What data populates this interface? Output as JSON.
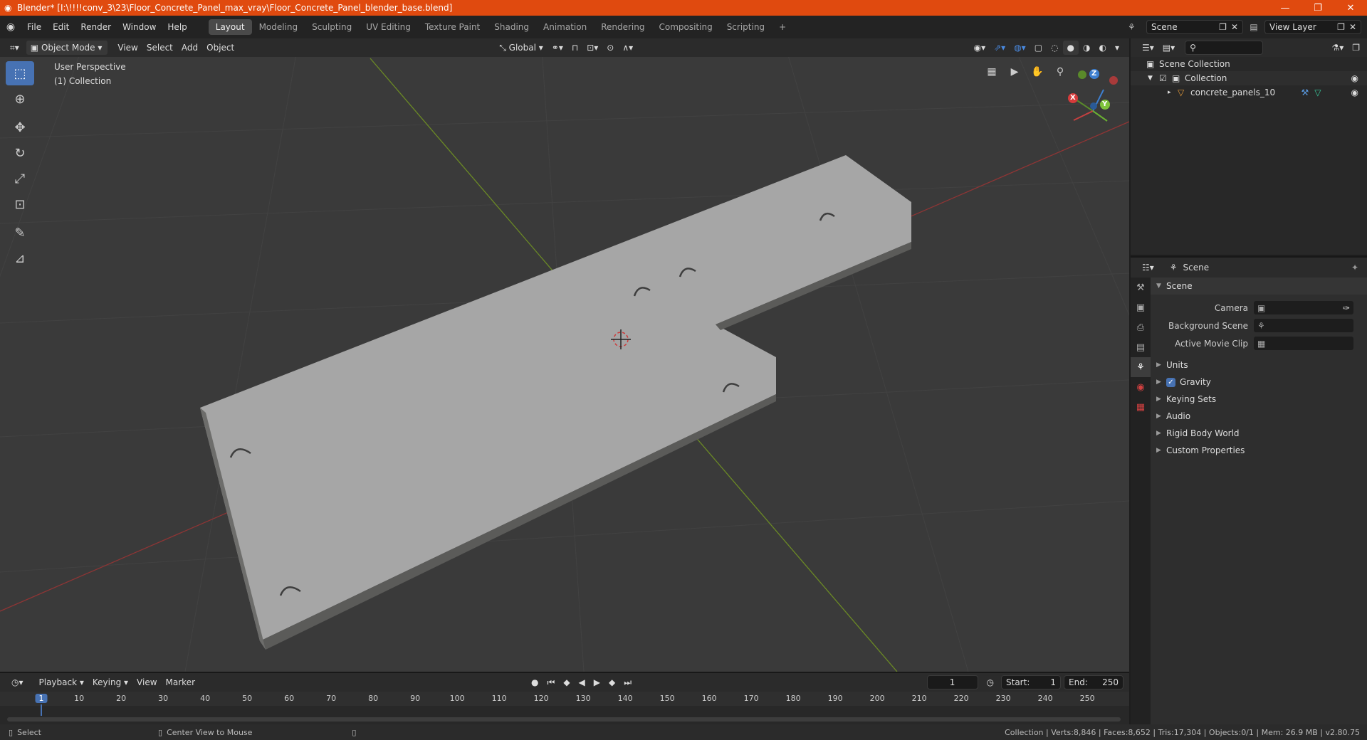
{
  "window": {
    "title": "Blender* [I:\\!!!!conv_3\\23\\Floor_Concrete_Panel_max_vray\\Floor_Concrete_Panel_blender_base.blend]",
    "minimize": "—",
    "maximize": "❐",
    "close": "✕"
  },
  "menu": {
    "items": [
      "File",
      "Edit",
      "Render",
      "Window",
      "Help"
    ],
    "workspaces": [
      "Layout",
      "Modeling",
      "Sculpting",
      "UV Editing",
      "Texture Paint",
      "Shading",
      "Animation",
      "Rendering",
      "Compositing",
      "Scripting"
    ],
    "add_tab": "+",
    "scene": "Scene",
    "view_layer": "View Layer"
  },
  "viewport": {
    "mode": "Object Mode",
    "menus": [
      "View",
      "Select",
      "Add",
      "Object"
    ],
    "orientation": "Global",
    "info_line1": "User Perspective",
    "info_line2": "(1) Collection",
    "axis_x": "X",
    "axis_y": "Y",
    "axis_z": "Z",
    "colors": {
      "background": "#3a3a3a",
      "grid": "#444444",
      "x_axis": "#9a3a3a",
      "y_axis": "#6a8a2a",
      "panel_top": "#a7a7a7",
      "panel_side": "#5a5a58"
    }
  },
  "outliner": {
    "root": "Scene Collection",
    "collection": "Collection",
    "object": "concrete_panels_10"
  },
  "properties": {
    "context": "Scene",
    "section": "Scene",
    "camera_label": "Camera",
    "background_scene_label": "Background Scene",
    "active_movie_clip_label": "Active Movie Clip",
    "subpanels": [
      "Units",
      "Gravity",
      "Keying Sets",
      "Audio",
      "Rigid Body World",
      "Custom Properties"
    ]
  },
  "timeline": {
    "menus": [
      "Playback",
      "Keying",
      "View",
      "Marker"
    ],
    "current_frame": "1",
    "start_label": "Start:",
    "start": "1",
    "end_label": "End:",
    "end": "250",
    "ticks": [
      "1",
      "10",
      "20",
      "30",
      "40",
      "50",
      "60",
      "70",
      "80",
      "90",
      "100",
      "110",
      "120",
      "130",
      "140",
      "150",
      "160",
      "170",
      "180",
      "190",
      "200",
      "210",
      "220",
      "230",
      "240",
      "250"
    ]
  },
  "status": {
    "left1": "Select",
    "left2": "Center View to Mouse",
    "right": "Collection | Verts:8,846 | Faces:8,652 | Tris:17,304 | Objects:0/1 | Mem: 26.9 MB | v2.80.75"
  }
}
